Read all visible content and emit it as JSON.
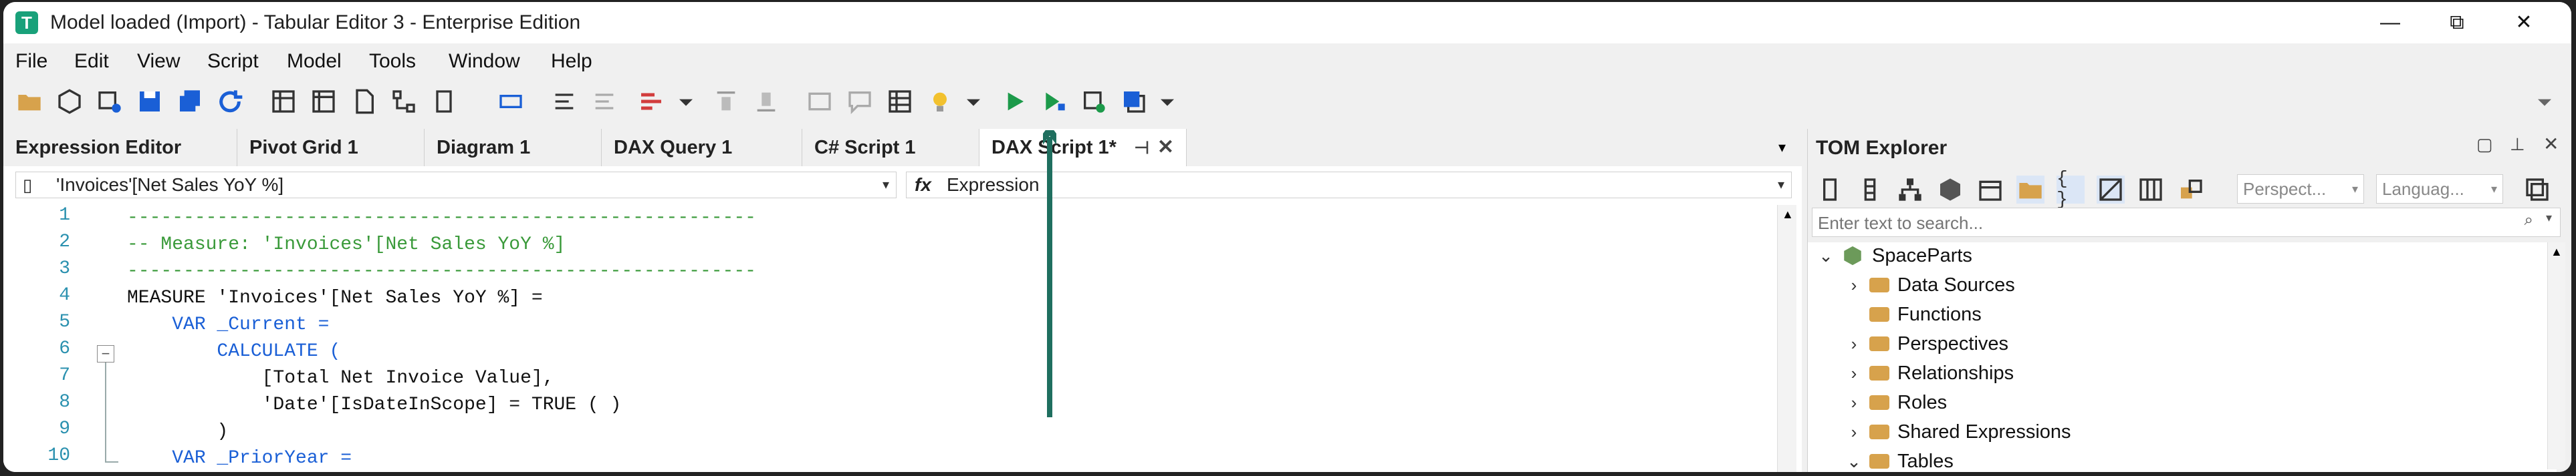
{
  "window": {
    "title": "Model loaded (Import) - Tabular Editor 3 - Enterprise Edition",
    "controls": [
      "—",
      "⧉",
      "✕"
    ]
  },
  "menu": [
    "File",
    "Edit",
    "View",
    "Script",
    "Model",
    "Tools",
    "Window",
    "Help"
  ],
  "tabs": [
    {
      "label": "Expression Editor"
    },
    {
      "label": "Pivot Grid 1"
    },
    {
      "label": "Diagram 1"
    },
    {
      "label": "DAX Query 1"
    },
    {
      "label": "C# Script 1"
    },
    {
      "label": "DAX Script 1*",
      "active": true
    }
  ],
  "editor": {
    "object_selector": "'Invoices'[Net Sales YoY %]",
    "property_selector": "Expression",
    "fx_label": "fx",
    "lines": [
      {
        "n": "1",
        "text": "--------------------------------------------------------"
      },
      {
        "n": "2",
        "text": "-- Measure: 'Invoices'[Net Sales YoY %]"
      },
      {
        "n": "3",
        "text": "--------------------------------------------------------"
      },
      {
        "n": "4",
        "text": "MEASURE 'Invoices'[Net Sales YoY %] ="
      },
      {
        "n": "5",
        "text": "    VAR _Current ="
      },
      {
        "n": "6",
        "text": "        CALCULATE ("
      },
      {
        "n": "7",
        "text": "            [Total Net Invoice Value],"
      },
      {
        "n": "8",
        "text": "            'Date'[IsDateInScope] = TRUE ( )"
      },
      {
        "n": "9",
        "text": "        )"
      },
      {
        "n": "10",
        "text": "    VAR _PriorYear ="
      }
    ]
  },
  "tom": {
    "title": "TOM Explorer",
    "search_placeholder": "Enter text to search...",
    "perspective": "Perspect...",
    "language": "Languag...",
    "tree": [
      {
        "label": "SpaceParts",
        "level": 0,
        "root": true
      },
      {
        "label": "Data Sources",
        "level": 1,
        "expandable": true
      },
      {
        "label": "Functions",
        "level": 1,
        "expandable": false
      },
      {
        "label": "Perspectives",
        "level": 1,
        "expandable": true
      },
      {
        "label": "Relationships",
        "level": 1,
        "expandable": true
      },
      {
        "label": "Roles",
        "level": 1,
        "expandable": true
      },
      {
        "label": "Shared Expressions",
        "level": 1,
        "expandable": true
      },
      {
        "label": "Tables",
        "level": 1,
        "expandable": true
      }
    ]
  },
  "colors": {
    "comment": "#3a9a3a",
    "keyword": "#1a5fd6",
    "line_number": "#2b91af",
    "accent": "#19a17a",
    "arrow": "#1f6f5f"
  }
}
